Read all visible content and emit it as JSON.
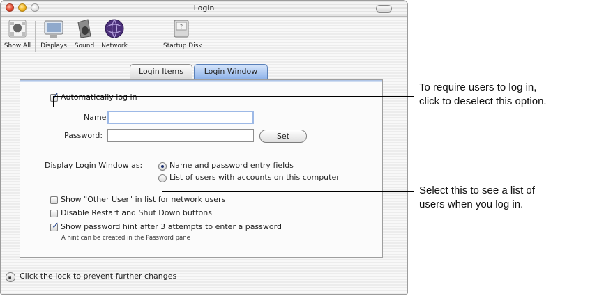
{
  "window": {
    "title": "Login"
  },
  "toolbar": {
    "items": [
      {
        "label": "Show All",
        "icon": "apple-grid-icon"
      },
      {
        "label": "Displays",
        "icon": "display-icon"
      },
      {
        "label": "Sound",
        "icon": "speaker-icon"
      },
      {
        "label": "Network",
        "icon": "globe-icon"
      },
      {
        "label": "Startup Disk",
        "icon": "disk-icon"
      }
    ]
  },
  "tabs": [
    {
      "label": "Login Items",
      "active": false
    },
    {
      "label": "Login Window",
      "active": true
    }
  ],
  "autologin": {
    "label": "Automatically log in",
    "checked": true,
    "name_label": "Name:",
    "name_value": "",
    "password_label": "Password:",
    "password_value": "",
    "set_button": "Set"
  },
  "display_as": {
    "label": "Display Login Window as:",
    "options": [
      {
        "label": "Name and password entry fields",
        "selected": true
      },
      {
        "label": "List of users with accounts on this computer",
        "selected": false
      }
    ]
  },
  "options": [
    {
      "label": "Show \"Other User\" in list for network users",
      "checked": false
    },
    {
      "label": "Disable Restart and Shut Down buttons",
      "checked": false
    },
    {
      "label": "Show password hint after 3 attempts to enter a password",
      "checked": true
    }
  ],
  "hint_note": "A hint can be created in the Password pane",
  "lock_text": "Click the lock to prevent further changes",
  "callouts": [
    {
      "line1": "To require users to log in,",
      "line2": "click to deselect this option."
    },
    {
      "line1": "Select this to see a list of",
      "line2": "users when you log in."
    }
  ]
}
